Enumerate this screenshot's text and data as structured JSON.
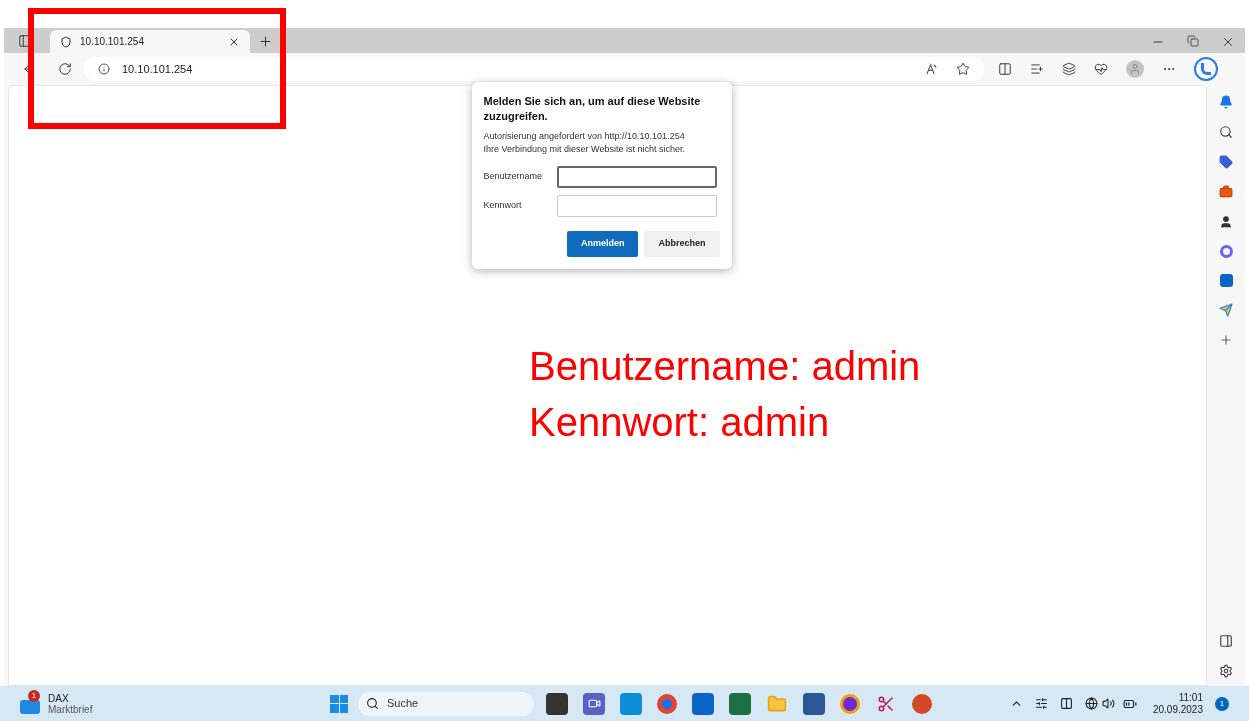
{
  "tab": {
    "title": "10.10.101.254",
    "selected": true
  },
  "address_bar": {
    "url": "10.10.101.254"
  },
  "dialog": {
    "title": "Melden Sie sich an, um auf diese Website zuzugreifen.",
    "description_lines": [
      "Autorisierung angefordert von http://10.10.101.254",
      "Ihre Verbindung mit dieser Website ist nicht sicher."
    ],
    "fields": [
      {
        "label": "Benutzername",
        "focused": true
      },
      {
        "label": "Kennwort",
        "focused": false
      }
    ],
    "buttons": [
      {
        "label": "Anmelden",
        "kind": "primary"
      },
      {
        "label": "Abbrechen",
        "kind": "secondary"
      }
    ]
  },
  "annotation": {
    "lines": [
      "Benutzername: admin",
      "Kennwort: admin"
    ]
  },
  "taskbar": {
    "widget": {
      "badge": "1",
      "title": "DAX",
      "subtitle": "Marktbrief"
    },
    "search": {
      "placeholder": "Suche"
    },
    "clock": {
      "time": "11:01",
      "date": "20.09.2023"
    },
    "notification_badge": "1"
  }
}
